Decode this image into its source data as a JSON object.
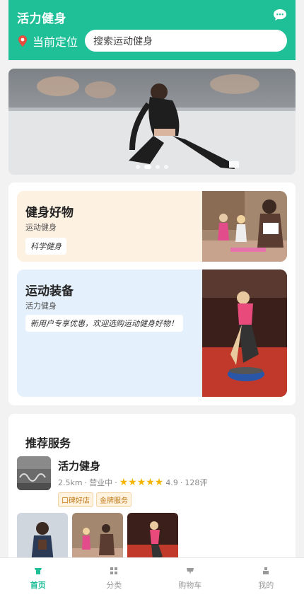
{
  "header": {
    "app_title": "活力健身",
    "location_label": "当前定位",
    "search_placeholder": "搜索运动健身"
  },
  "banner": {
    "dots": 4,
    "active_dot": 2
  },
  "categories": [
    {
      "title": "健身好物",
      "subtitle": "运动健身",
      "tag": "科学健身"
    },
    {
      "title": "运动装备",
      "subtitle": "活力健身",
      "tag": "新用户专享优惠，欢迎选购运动健身好物！"
    }
  ],
  "recommended": {
    "section_title": "推荐服务",
    "shop": {
      "name": "活力健身",
      "distance": "2.5km",
      "status": "营业中",
      "stars": "★★★★★",
      "rating": "4.9",
      "reviews": "128评",
      "badges": [
        "口碑好店",
        "金牌服务"
      ]
    }
  },
  "tabbar": [
    {
      "label": "首页",
      "icon": "home-icon",
      "active": true
    },
    {
      "label": "分类",
      "icon": "grid-icon",
      "active": false
    },
    {
      "label": "购物车",
      "icon": "cart-icon",
      "active": false
    },
    {
      "label": "我的",
      "icon": "user-icon",
      "active": false
    }
  ],
  "colors": {
    "brand": "#1fbf98",
    "star": "#f5b400",
    "promo1_bg": "#fdf1e2",
    "promo2_bg": "#e4f0fb"
  }
}
